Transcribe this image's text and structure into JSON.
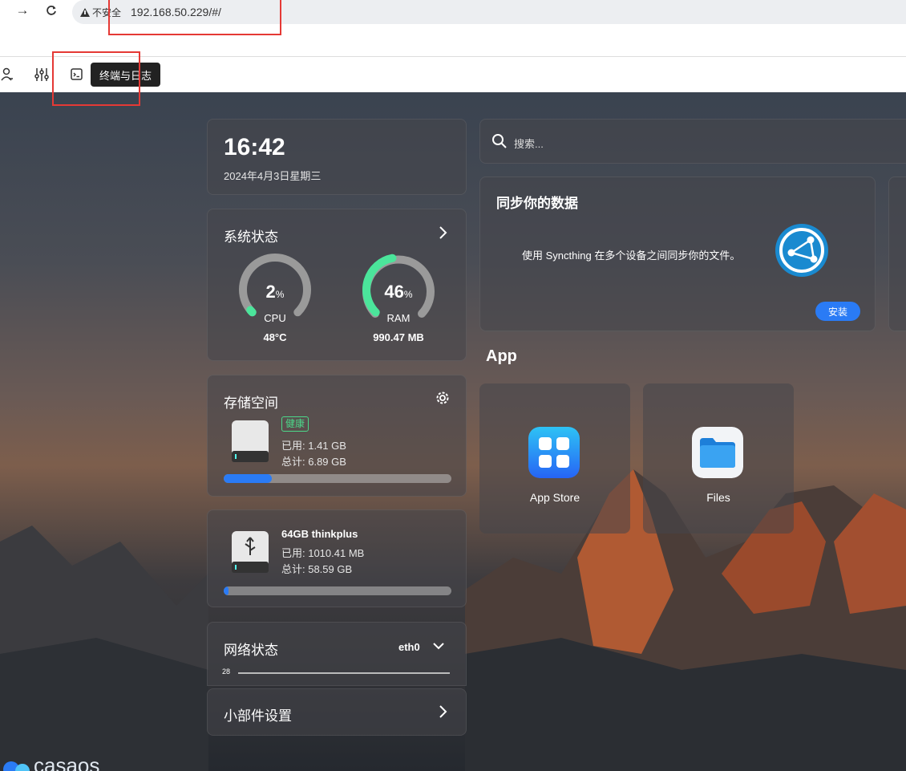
{
  "browser": {
    "insecure_label": "不安全",
    "url": "192.168.50.229/#/"
  },
  "toolbar": {
    "tooltip": "终端与日志"
  },
  "clock": {
    "time": "16:42",
    "date": "2024年4月3日星期三"
  },
  "system_status": {
    "title": "系统状态",
    "cpu": {
      "value": "2",
      "unit": "%",
      "label": "CPU",
      "temp": "48°C",
      "level": 0.02
    },
    "ram": {
      "value": "46",
      "unit": "%",
      "label": "RAM",
      "used": "990.47 MB",
      "level": 0.46
    }
  },
  "storage": {
    "title": "存储空间",
    "status_badge": "健康",
    "used": "已用: 1.41 GB",
    "total": "总计: 6.89 GB",
    "usage_fraction": 0.21
  },
  "usb": {
    "name": "64GB thinkplus",
    "used": "已用: 1010.41 MB",
    "total": "总计: 58.59 GB",
    "usage_fraction": 0.02
  },
  "network": {
    "title": "网络状态",
    "interface": "eth0",
    "axis_value": "28"
  },
  "widget_settings": {
    "title": "小部件设置"
  },
  "search": {
    "placeholder": "搜索..."
  },
  "sync_card": {
    "title": "同步你的数据",
    "description": "使用 Syncthing 在多个设备之间同步你的文件。",
    "install_label": "安装"
  },
  "apps": {
    "heading": "App",
    "items": [
      {
        "label": "App Store"
      },
      {
        "label": "Files"
      }
    ]
  },
  "colors": {
    "accent": "#2a7bf5",
    "healthy": "#4cd88a",
    "highlight": "#e53935"
  }
}
